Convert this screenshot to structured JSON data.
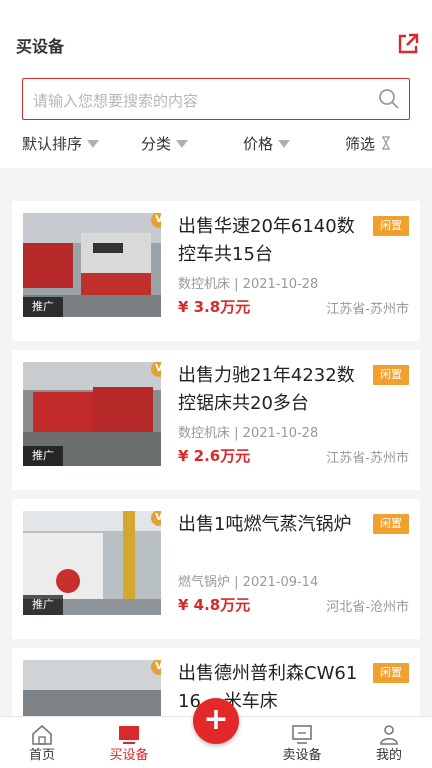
{
  "header": {
    "title": "买设备"
  },
  "search": {
    "placeholder": "请输入您想要搜索的内容"
  },
  "filters": [
    {
      "label": "默认排序"
    },
    {
      "label": "分类"
    },
    {
      "label": "价格"
    },
    {
      "label": "筛选"
    }
  ],
  "listings": [
    {
      "title": "出售华速20年6140数控车共15台",
      "badge": "闲置",
      "promo": "推广",
      "category": "数控机床",
      "date": "2021-10-28",
      "price": "¥ 3.8万元",
      "location": "江苏省-苏州市"
    },
    {
      "title": "出售力驰21年4232数控锯床共20多台",
      "badge": "闲置",
      "promo": "推广",
      "category": "数控机床",
      "date": "2021-10-28",
      "price": "¥ 2.6万元",
      "location": "江苏省-苏州市"
    },
    {
      "title": "出售1吨燃气蒸汽锅炉",
      "badge": "闲置",
      "promo": "推广",
      "category": "燃气锅炉",
      "date": "2021-09-14",
      "price": "¥ 4.8万元",
      "location": "河北省-沧州市"
    },
    {
      "title": "出售德州普利森CW61 16... 米车床",
      "badge": "闲置"
    }
  ],
  "nav": {
    "home": "首页",
    "buy": "买设备",
    "sell": "卖设备",
    "mine": "我的",
    "fab": "+"
  },
  "colors": {
    "accent": "#d9292a",
    "badge": "#f0a02e"
  }
}
